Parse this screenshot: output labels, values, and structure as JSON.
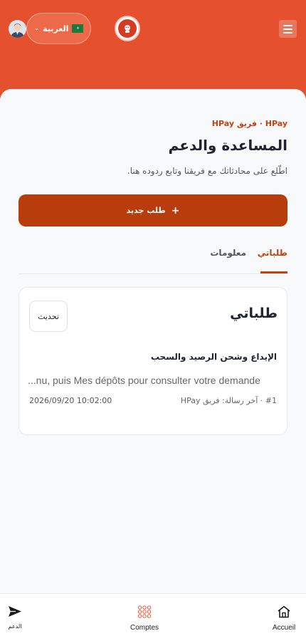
{
  "header": {
    "language": {
      "label": "العربية",
      "flag_icon": "saudi-flag-icon"
    },
    "menu_icon": "hamburger-menu-icon",
    "logo_icon": "brand-logo-icon",
    "avatar_icon": "user-avatar-icon",
    "color": "#e5512e"
  },
  "page": {
    "breadcrumb": "HPay · فريق HPay",
    "title": "المساعدة والدعم",
    "subtitle": "اطّلع على محادثاتك مع فريقنا وتابع ردوده هنا.",
    "new_request_label": "طلب جديد",
    "new_request_icon": "plus-icon",
    "accent": "#b83d0c"
  },
  "tabs": [
    {
      "label": "طلباتي",
      "active": true
    },
    {
      "label": "معلومات",
      "active": false
    }
  ],
  "requests_card": {
    "title": "طلباتي",
    "refresh_label": "تحديث",
    "items": [
      {
        "title": "الإيداع وشحن الرصيد والسحب",
        "preview": "...nu, puis Mes dépôts pour consulter votre demande",
        "meta": "#1 · آخر رسالة: فريق HPay",
        "date": "2026/09/20 10:02:00"
      }
    ]
  },
  "bottom_nav": [
    {
      "label": "الدعم",
      "icon": "send-icon"
    },
    {
      "label": "Comptes",
      "icon": "grid-dots-icon"
    },
    {
      "label": "Accueil",
      "icon": "home-icon"
    }
  ]
}
